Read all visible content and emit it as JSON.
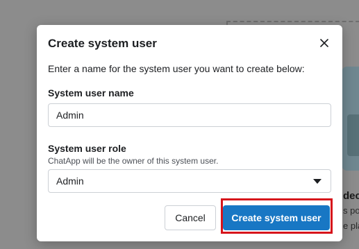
{
  "background": {
    "heading_fragment": "dec",
    "line1_fragment": "s po",
    "line2_fragment": "e pla"
  },
  "dialog": {
    "title": "Create system user",
    "close_icon": "close-icon",
    "intro": "Enter a name for the system user you want to create below:",
    "name_label": "System user name",
    "name_value": "Admin",
    "role_label": "System user role",
    "role_sublabel": "ChatApp will be the owner of this system user.",
    "role_value": "Admin",
    "cancel_label": "Cancel",
    "create_label": "Create system user"
  },
  "colors": {
    "primary": "#1877c4",
    "highlight": "#d6141b"
  }
}
